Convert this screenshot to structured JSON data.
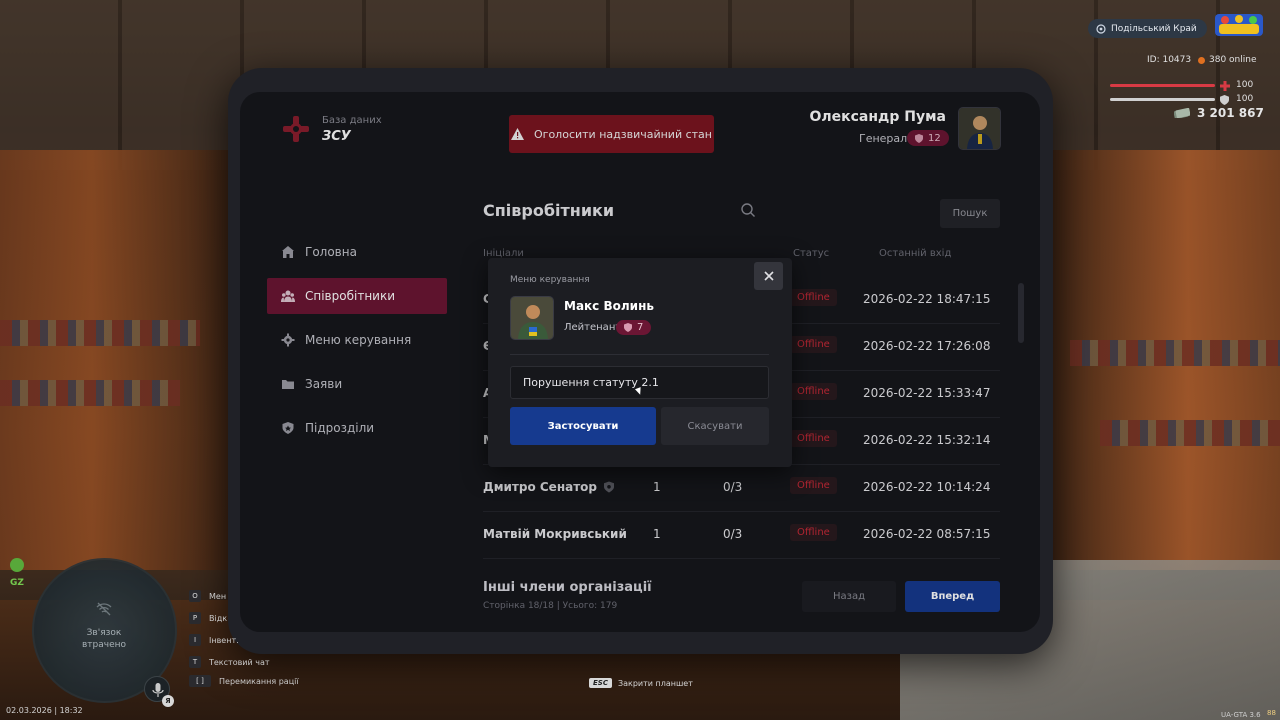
{
  "header": {
    "db_label": "База даних",
    "db_name": "ЗСУ",
    "alert_button": "Оголосити надзвичайний стан",
    "user_name": "Олександр Пума",
    "user_rank": "Генерал",
    "user_rank_level": "12"
  },
  "sidebar": {
    "items": [
      {
        "label": "Головна",
        "icon": "home-icon",
        "active": false
      },
      {
        "label": "Співробітники",
        "icon": "users-icon",
        "active": true
      },
      {
        "label": "Меню керування",
        "icon": "gear-icon",
        "active": false
      },
      {
        "label": "Заяви",
        "icon": "folder-icon",
        "active": false
      },
      {
        "label": "Підрозділи",
        "icon": "shield-icon",
        "active": false
      }
    ]
  },
  "main": {
    "title": "Співробітники",
    "search_button": "Пошук",
    "columns": [
      "Ініціали",
      "",
      "",
      "Статус",
      "Останній вхід"
    ],
    "rows": [
      {
        "name": "С",
        "level": "",
        "warns": "",
        "status": "Offline",
        "last_login": "2026-02-22 18:47:15"
      },
      {
        "name": "Є",
        "level": "",
        "warns": "",
        "status": "Offline",
        "last_login": "2026-02-22 17:26:08"
      },
      {
        "name": "А",
        "level": "",
        "warns": "",
        "status": "Offline",
        "last_login": "2026-02-22 15:33:47"
      },
      {
        "name": "М",
        "level": "",
        "warns": "",
        "status": "Offline",
        "last_login": "2026-02-22 15:32:14"
      },
      {
        "name": "Дмитро Сенатор",
        "level": "1",
        "warns": "0/3",
        "status": "Offline",
        "last_login": "2026-02-22 10:14:24"
      },
      {
        "name": "Матвій Мокривський",
        "level": "1",
        "warns": "0/3",
        "status": "Offline",
        "last_login": "2026-02-22 08:57:15"
      }
    ],
    "footer_title": "Інші члени організації",
    "footer_sub": "Сторінка 18/18 | Усього: 179",
    "back_button": "Назад",
    "next_button": "Вперед"
  },
  "modal": {
    "title": "Меню керування",
    "name": "Макс Волинь",
    "rank": "Лейтенант",
    "rank_level": "7",
    "input_value": "Порушення статуту 2.1",
    "apply_button": "Застосувати",
    "cancel_button": "Скасувати"
  },
  "hud": {
    "server": "Подільський Край",
    "id": "ID: 10473",
    "online": "380 online",
    "health": "100",
    "armor": "100",
    "money": "3 201 867",
    "health_fraction": 1.0,
    "armor_fraction": 1.0,
    "minimap_text": "Зв'язок втрачено",
    "gz": "GZ",
    "mic_key": "Я",
    "hotkeys": [
      {
        "key": "O",
        "label": "Мен"
      },
      {
        "key": "P",
        "label": "Відк"
      },
      {
        "key": "I",
        "label": "Інвент."
      },
      {
        "key": "T",
        "label": "Текстовий чат"
      },
      {
        "key": "[ ]",
        "label": "Перемикання рації"
      }
    ],
    "datetime": "02.03.2026 | 18:32",
    "esc_key": "ESC",
    "esc_label": "Закрити планшет",
    "version": "UA-GTA 3.6",
    "version_num": "88"
  },
  "colors": {
    "accent_red": "#6b1634",
    "primary_blue": "#163a8f",
    "alert_red": "#7b1520",
    "status_offline": "#c92a38"
  }
}
